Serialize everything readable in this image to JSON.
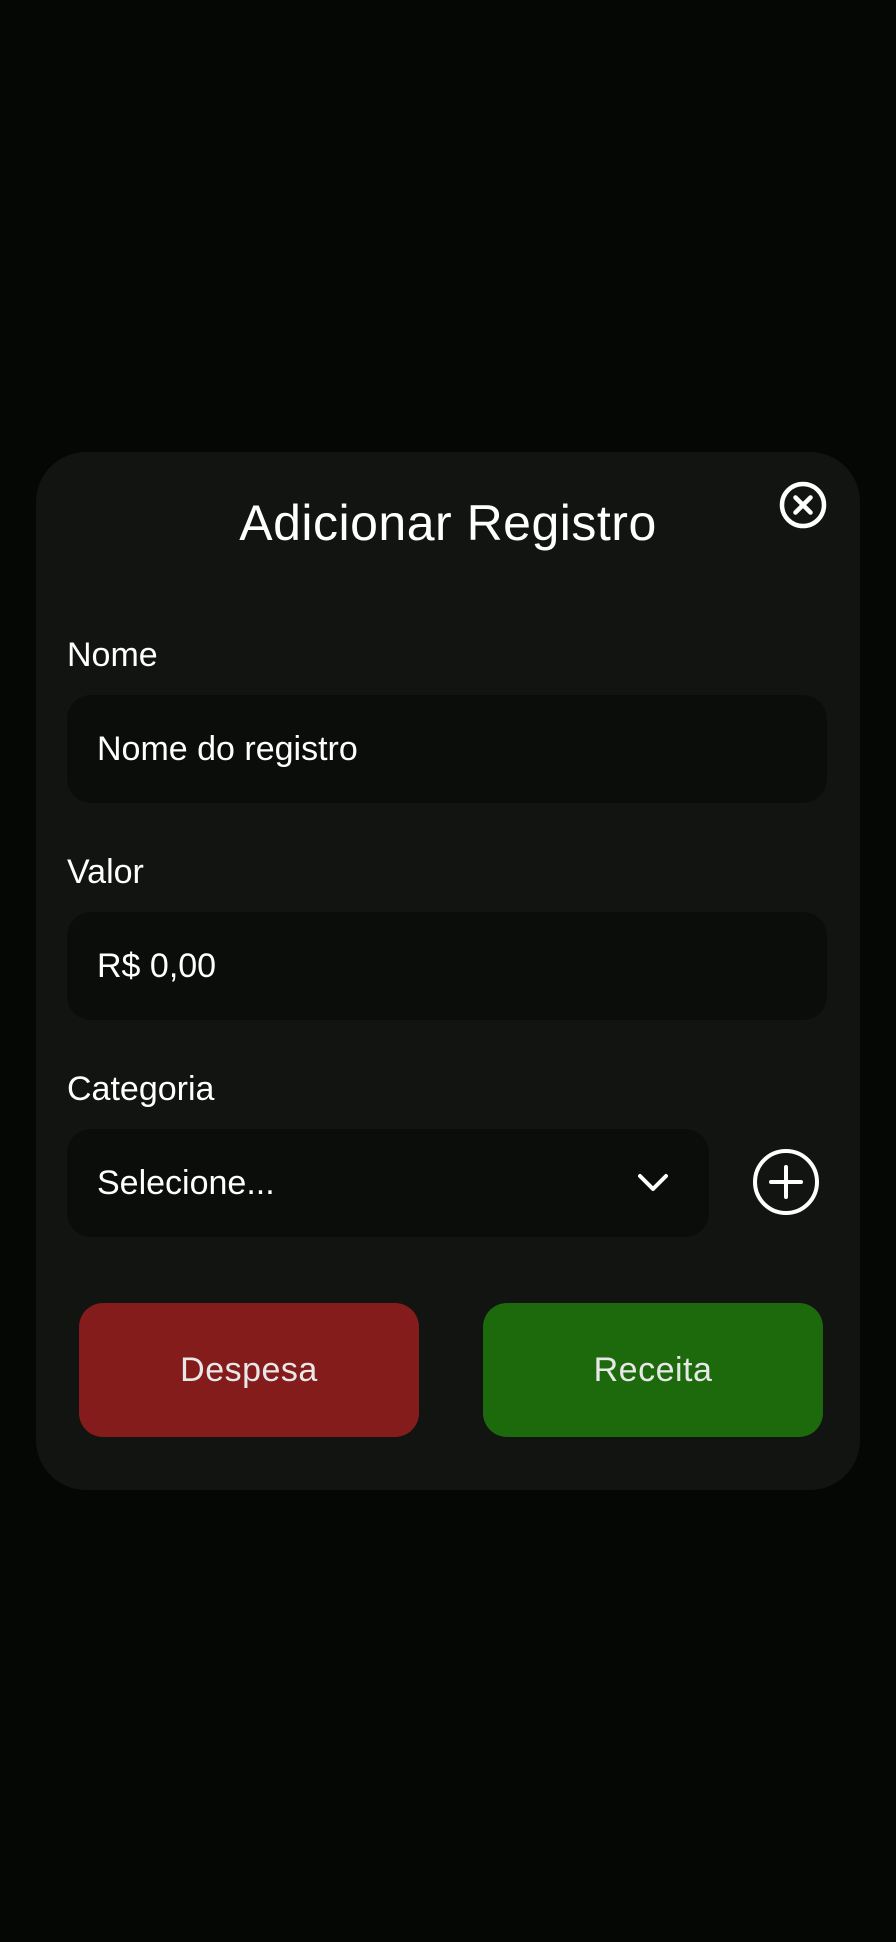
{
  "modal": {
    "title": "Adicionar Registro"
  },
  "fields": {
    "name": {
      "label": "Nome",
      "placeholder": "Nome do registro",
      "value": ""
    },
    "amount": {
      "label": "Valor",
      "value": "R$ 0,00"
    },
    "category": {
      "label": "Categoria",
      "selected": "Selecione..."
    }
  },
  "buttons": {
    "expense": "Despesa",
    "income": "Receita"
  },
  "icons": {
    "close": "close-circle-icon",
    "dropdown": "chevron-down-icon",
    "add_category": "plus-circle-icon"
  },
  "colors": {
    "background": "#050705",
    "modal": "#121412",
    "field": "#0b0d0b",
    "expense": "#841c1c",
    "income": "#1d6a0c",
    "text": "#ffffff"
  }
}
